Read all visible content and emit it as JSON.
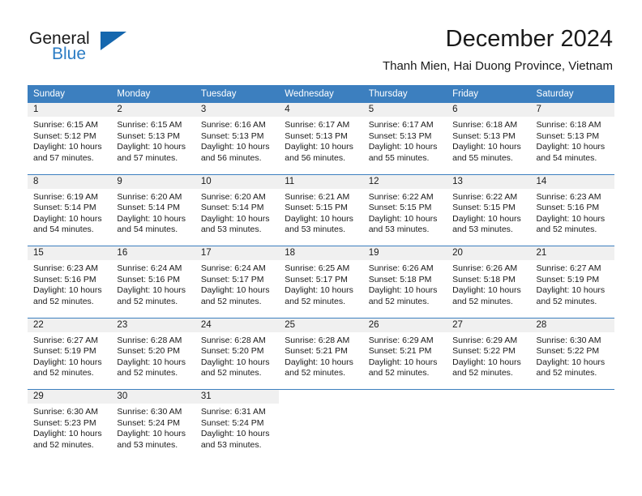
{
  "brand": {
    "word_one": "General",
    "word_two": "Blue",
    "triangle_icon": "blue-triangle-logo-icon"
  },
  "header": {
    "title": "December 2024",
    "subtitle": "Thanh Mien, Hai Duong Province, Vietnam"
  },
  "colors": {
    "header_blue": "#3c7fbf",
    "logo_blue": "#1567ae",
    "brand_blue_text": "#2b7cc4",
    "day_number_band": "#f0f0f0",
    "text": "#1a1a1a"
  },
  "weekday_headers": [
    "Sunday",
    "Monday",
    "Tuesday",
    "Wednesday",
    "Thursday",
    "Friday",
    "Saturday"
  ],
  "weeks": [
    [
      {
        "day": "1",
        "sunrise": "Sunrise: 6:15 AM",
        "sunset": "Sunset: 5:12 PM",
        "daylight": "Daylight: 10 hours and 57 minutes."
      },
      {
        "day": "2",
        "sunrise": "Sunrise: 6:15 AM",
        "sunset": "Sunset: 5:13 PM",
        "daylight": "Daylight: 10 hours and 57 minutes."
      },
      {
        "day": "3",
        "sunrise": "Sunrise: 6:16 AM",
        "sunset": "Sunset: 5:13 PM",
        "daylight": "Daylight: 10 hours and 56 minutes."
      },
      {
        "day": "4",
        "sunrise": "Sunrise: 6:17 AM",
        "sunset": "Sunset: 5:13 PM",
        "daylight": "Daylight: 10 hours and 56 minutes."
      },
      {
        "day": "5",
        "sunrise": "Sunrise: 6:17 AM",
        "sunset": "Sunset: 5:13 PM",
        "daylight": "Daylight: 10 hours and 55 minutes."
      },
      {
        "day": "6",
        "sunrise": "Sunrise: 6:18 AM",
        "sunset": "Sunset: 5:13 PM",
        "daylight": "Daylight: 10 hours and 55 minutes."
      },
      {
        "day": "7",
        "sunrise": "Sunrise: 6:18 AM",
        "sunset": "Sunset: 5:13 PM",
        "daylight": "Daylight: 10 hours and 54 minutes."
      }
    ],
    [
      {
        "day": "8",
        "sunrise": "Sunrise: 6:19 AM",
        "sunset": "Sunset: 5:14 PM",
        "daylight": "Daylight: 10 hours and 54 minutes."
      },
      {
        "day": "9",
        "sunrise": "Sunrise: 6:20 AM",
        "sunset": "Sunset: 5:14 PM",
        "daylight": "Daylight: 10 hours and 54 minutes."
      },
      {
        "day": "10",
        "sunrise": "Sunrise: 6:20 AM",
        "sunset": "Sunset: 5:14 PM",
        "daylight": "Daylight: 10 hours and 53 minutes."
      },
      {
        "day": "11",
        "sunrise": "Sunrise: 6:21 AM",
        "sunset": "Sunset: 5:15 PM",
        "daylight": "Daylight: 10 hours and 53 minutes."
      },
      {
        "day": "12",
        "sunrise": "Sunrise: 6:22 AM",
        "sunset": "Sunset: 5:15 PM",
        "daylight": "Daylight: 10 hours and 53 minutes."
      },
      {
        "day": "13",
        "sunrise": "Sunrise: 6:22 AM",
        "sunset": "Sunset: 5:15 PM",
        "daylight": "Daylight: 10 hours and 53 minutes."
      },
      {
        "day": "14",
        "sunrise": "Sunrise: 6:23 AM",
        "sunset": "Sunset: 5:16 PM",
        "daylight": "Daylight: 10 hours and 52 minutes."
      }
    ],
    [
      {
        "day": "15",
        "sunrise": "Sunrise: 6:23 AM",
        "sunset": "Sunset: 5:16 PM",
        "daylight": "Daylight: 10 hours and 52 minutes."
      },
      {
        "day": "16",
        "sunrise": "Sunrise: 6:24 AM",
        "sunset": "Sunset: 5:16 PM",
        "daylight": "Daylight: 10 hours and 52 minutes."
      },
      {
        "day": "17",
        "sunrise": "Sunrise: 6:24 AM",
        "sunset": "Sunset: 5:17 PM",
        "daylight": "Daylight: 10 hours and 52 minutes."
      },
      {
        "day": "18",
        "sunrise": "Sunrise: 6:25 AM",
        "sunset": "Sunset: 5:17 PM",
        "daylight": "Daylight: 10 hours and 52 minutes."
      },
      {
        "day": "19",
        "sunrise": "Sunrise: 6:26 AM",
        "sunset": "Sunset: 5:18 PM",
        "daylight": "Daylight: 10 hours and 52 minutes."
      },
      {
        "day": "20",
        "sunrise": "Sunrise: 6:26 AM",
        "sunset": "Sunset: 5:18 PM",
        "daylight": "Daylight: 10 hours and 52 minutes."
      },
      {
        "day": "21",
        "sunrise": "Sunrise: 6:27 AM",
        "sunset": "Sunset: 5:19 PM",
        "daylight": "Daylight: 10 hours and 52 minutes."
      }
    ],
    [
      {
        "day": "22",
        "sunrise": "Sunrise: 6:27 AM",
        "sunset": "Sunset: 5:19 PM",
        "daylight": "Daylight: 10 hours and 52 minutes."
      },
      {
        "day": "23",
        "sunrise": "Sunrise: 6:28 AM",
        "sunset": "Sunset: 5:20 PM",
        "daylight": "Daylight: 10 hours and 52 minutes."
      },
      {
        "day": "24",
        "sunrise": "Sunrise: 6:28 AM",
        "sunset": "Sunset: 5:20 PM",
        "daylight": "Daylight: 10 hours and 52 minutes."
      },
      {
        "day": "25",
        "sunrise": "Sunrise: 6:28 AM",
        "sunset": "Sunset: 5:21 PM",
        "daylight": "Daylight: 10 hours and 52 minutes."
      },
      {
        "day": "26",
        "sunrise": "Sunrise: 6:29 AM",
        "sunset": "Sunset: 5:21 PM",
        "daylight": "Daylight: 10 hours and 52 minutes."
      },
      {
        "day": "27",
        "sunrise": "Sunrise: 6:29 AM",
        "sunset": "Sunset: 5:22 PM",
        "daylight": "Daylight: 10 hours and 52 minutes."
      },
      {
        "day": "28",
        "sunrise": "Sunrise: 6:30 AM",
        "sunset": "Sunset: 5:22 PM",
        "daylight": "Daylight: 10 hours and 52 minutes."
      }
    ],
    [
      {
        "day": "29",
        "sunrise": "Sunrise: 6:30 AM",
        "sunset": "Sunset: 5:23 PM",
        "daylight": "Daylight: 10 hours and 52 minutes."
      },
      {
        "day": "30",
        "sunrise": "Sunrise: 6:30 AM",
        "sunset": "Sunset: 5:24 PM",
        "daylight": "Daylight: 10 hours and 53 minutes."
      },
      {
        "day": "31",
        "sunrise": "Sunrise: 6:31 AM",
        "sunset": "Sunset: 5:24 PM",
        "daylight": "Daylight: 10 hours and 53 minutes."
      },
      {
        "day": "",
        "sunrise": "",
        "sunset": "",
        "daylight": ""
      },
      {
        "day": "",
        "sunrise": "",
        "sunset": "",
        "daylight": ""
      },
      {
        "day": "",
        "sunrise": "",
        "sunset": "",
        "daylight": ""
      },
      {
        "day": "",
        "sunrise": "",
        "sunset": "",
        "daylight": ""
      }
    ]
  ]
}
